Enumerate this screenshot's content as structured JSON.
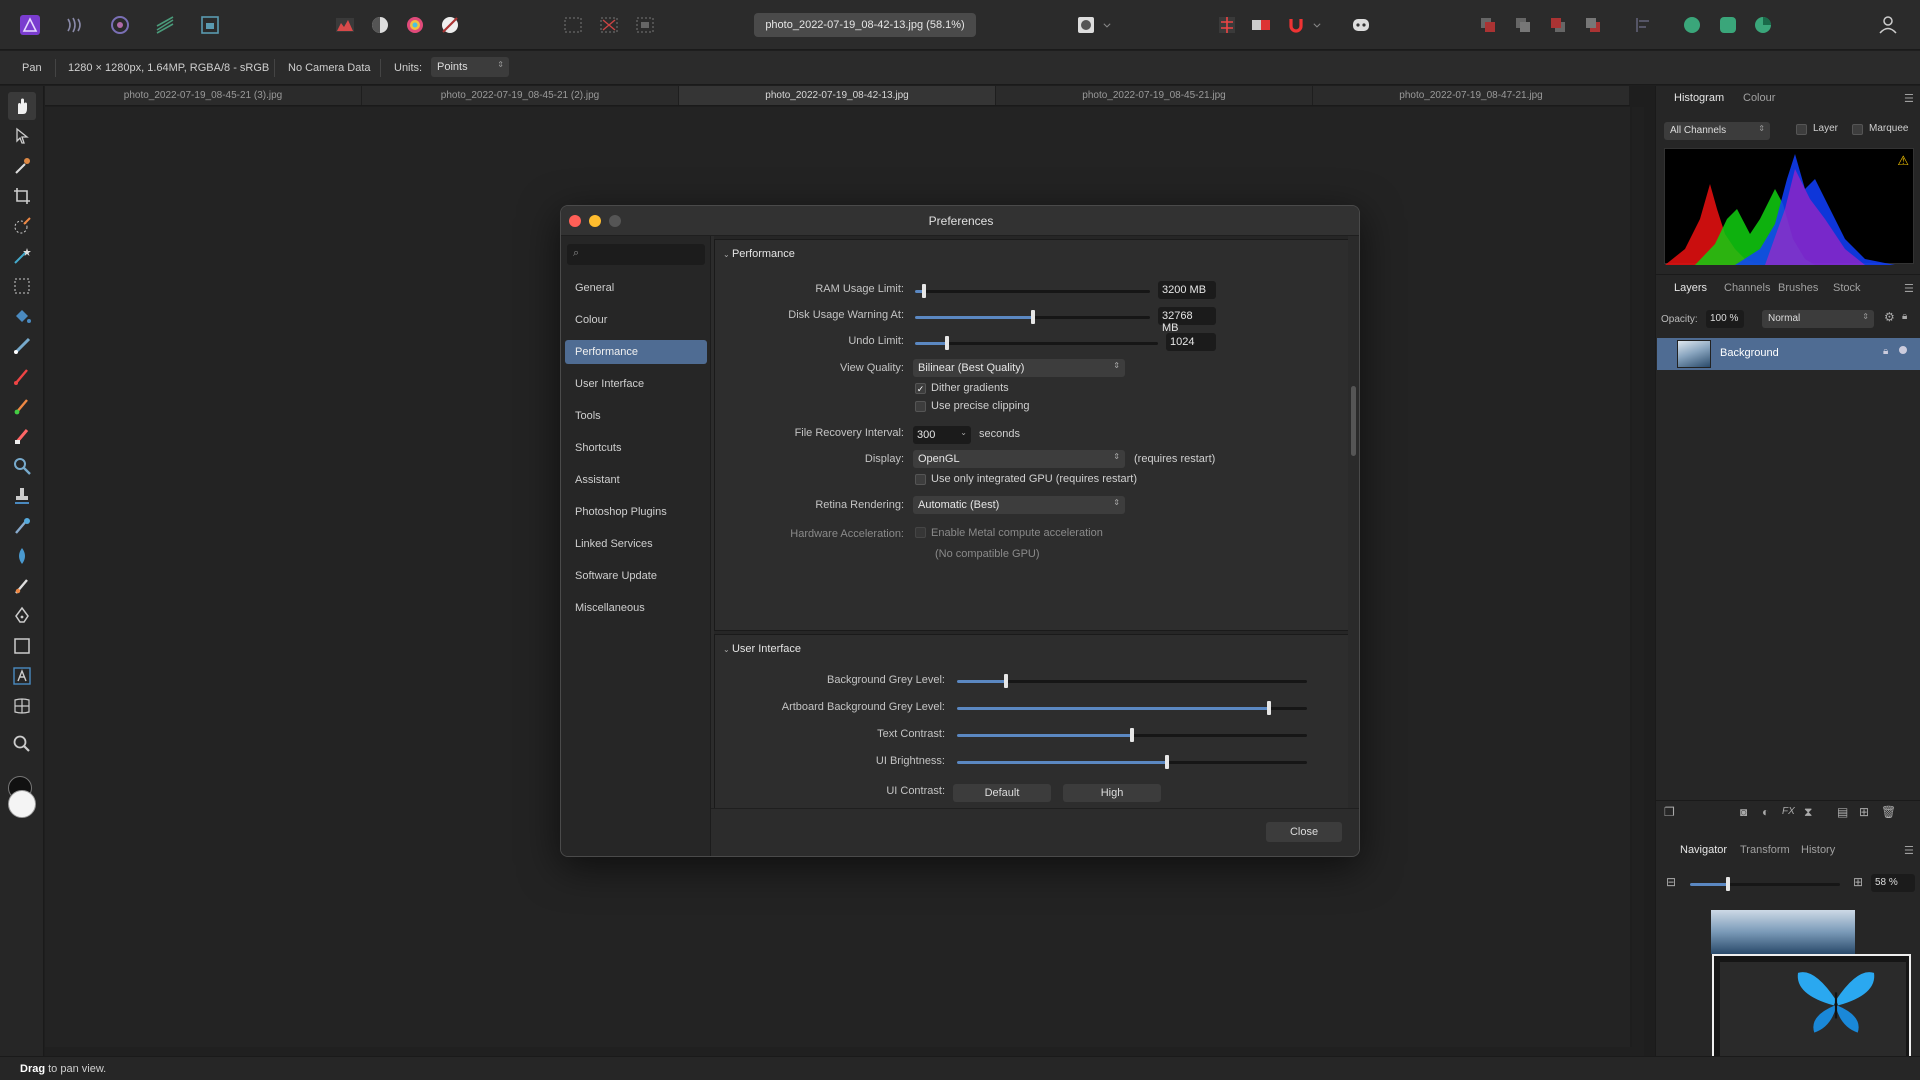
{
  "document": {
    "title": "photo_2022-07-19_08-42-13.jpg (58.1%)"
  },
  "context": {
    "tool": "Pan",
    "doc_info": "1280 × 1280px, 1.64MP, RGBA/8 - sRGB",
    "camera": "No Camera Data",
    "units_label": "Units:",
    "units_value": "Points"
  },
  "tabs": [
    "photo_2022-07-19_08-45-21 (3).jpg",
    "photo_2022-07-19_08-45-21 (2).jpg",
    "photo_2022-07-19_08-42-13.jpg",
    "photo_2022-07-19_08-45-21.jpg",
    "photo_2022-07-19_08-47-21.jpg"
  ],
  "preferences": {
    "title": "Preferences",
    "search_placeholder": "",
    "sidebar": [
      "General",
      "Colour",
      "Performance",
      "User Interface",
      "Tools",
      "Shortcuts",
      "Assistant",
      "Photoshop Plugins",
      "Linked Services",
      "Software Update",
      "Miscellaneous"
    ],
    "performance": {
      "heading": "Performance",
      "ram_label": "RAM Usage Limit:",
      "ram_value": "3200 MB",
      "ram_level": 0.04,
      "disk_label": "Disk Usage Warning At:",
      "disk_value": "32768 MB",
      "disk_level": 0.5,
      "undo_label": "Undo Limit:",
      "undo_value": "1024",
      "undo_level": 0.13,
      "view_quality_label": "View Quality:",
      "view_quality_value": "Bilinear (Best Quality)",
      "dither_label": "Dither gradients",
      "dither_checked": true,
      "precise_label": "Use precise clipping",
      "precise_checked": false,
      "recovery_label": "File Recovery Interval:",
      "recovery_value": "300",
      "recovery_unit": "seconds",
      "display_label": "Display:",
      "display_value": "OpenGL",
      "display_note": "(requires restart)",
      "integrated_label": "Use only integrated GPU (requires restart)",
      "integrated_checked": false,
      "retina_label": "Retina Rendering:",
      "retina_value": "Automatic (Best)",
      "hw_label": "Hardware Acceleration:",
      "metal_label": "Enable Metal compute acceleration",
      "metal_checked": false,
      "no_gpu": "(No compatible GPU)"
    },
    "user_interface": {
      "heading": "User Interface",
      "bg_grey_label": "Background Grey Level:",
      "bg_grey_level": 0.14,
      "artboard_label": "Artboard Background Grey Level:",
      "artboard_level": 0.89,
      "text_contrast_label": "Text Contrast:",
      "text_contrast_level": 0.5,
      "ui_brightness_label": "UI Brightness:",
      "ui_brightness_level": 0.6,
      "ui_contrast_label": "UI Contrast:",
      "contrast_default": "Default",
      "contrast_high": "High"
    },
    "close_label": "Close"
  },
  "panels": {
    "histogram_tabs": [
      "Histogram",
      "Colour"
    ],
    "channels_select": "All Channels",
    "layer_chk": "Layer",
    "marquee_chk": "Marquee",
    "layers_tabs": [
      "Layers",
      "Channels",
      "Brushes",
      "Stock"
    ],
    "opacity_label": "Opacity:",
    "opacity_value": "100 %",
    "blend_mode": "Normal",
    "layer_name": "Background",
    "nav_tabs": [
      "Navigator",
      "Transform",
      "History"
    ],
    "zoom_value": "58 %",
    "zoom_level": 0.25
  },
  "status": {
    "bold": "Drag",
    "text": " to pan view."
  },
  "colors": {
    "accent": "#4f6c93",
    "slider_fill": "#5b88c2",
    "close_red": "#ff5f57",
    "min_yellow": "#febc2e",
    "max_grey": "#555555"
  }
}
